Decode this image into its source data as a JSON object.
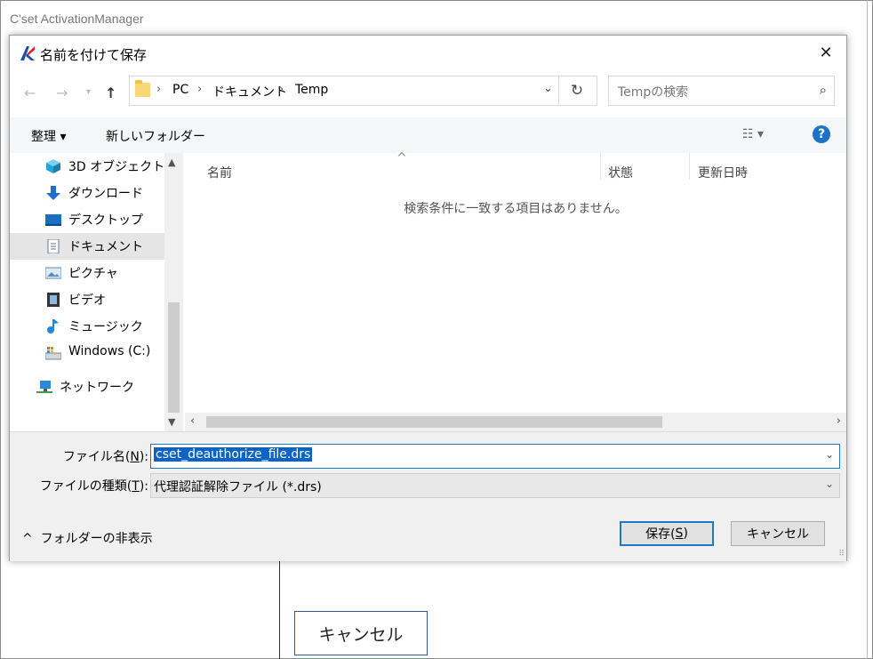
{
  "background_app": {
    "title": "C'set ActivationManager",
    "cancel_label": "キャンセル"
  },
  "dialog": {
    "title": "名前を付けて保存",
    "close_icon": "close-icon",
    "address": {
      "breadcrumbs": [
        "PC",
        "ドキュメント",
        "Temp"
      ]
    },
    "search": {
      "placeholder": "Tempの検索"
    },
    "toolbar": {
      "organize": "整理 ▾",
      "new_folder": "新しいフォルダー"
    },
    "nav": [
      {
        "label": "3D オブジェクト",
        "icon": "cube-icon",
        "color": "#2aa4d6"
      },
      {
        "label": "ダウンロード",
        "icon": "download-arrow-icon",
        "color": "#1c6fd1"
      },
      {
        "label": "デスクトップ",
        "icon": "desktop-icon",
        "color": "#1a6fc1"
      },
      {
        "label": "ドキュメント",
        "icon": "document-icon",
        "color": "#5a7a9a"
      },
      {
        "label": "ピクチャ",
        "icon": "picture-icon",
        "color": "#5b8ab8"
      },
      {
        "label": "ビデオ",
        "icon": "video-icon",
        "color": "#333333"
      },
      {
        "label": "ミュージック",
        "icon": "music-note-icon",
        "color": "#1e88e5"
      },
      {
        "label": "Windows (C:)",
        "icon": "drive-icon",
        "color": "#2f7fd0"
      },
      {
        "label": "ネットワーク",
        "icon": "network-icon",
        "color": "#2a8ad8"
      }
    ],
    "selected_nav": "ドキュメント",
    "columns": [
      "名前",
      "状態",
      "更新日時"
    ],
    "empty_message": "検索条件に一致する項目はありません。",
    "filename": {
      "label_prefix": "ファイル名(",
      "label_key": "N",
      "label_suffix": "):",
      "value": "cset_deauthorize_file.drs"
    },
    "filetype": {
      "label_prefix": "ファイルの種類(",
      "label_key": "T",
      "label_suffix": "):",
      "value": "代理認証解除ファイル (*.drs)"
    },
    "hide_folders": "フォルダーの非表示",
    "save": {
      "prefix": "保存(",
      "key": "S",
      "suffix": ")"
    },
    "cancel": "キャンセル",
    "accent_color": "#1979ca"
  }
}
